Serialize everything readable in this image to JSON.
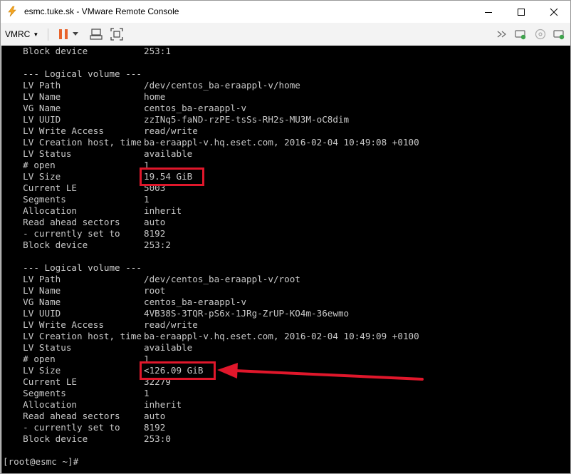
{
  "window": {
    "title": "esmc.tuke.sk - VMware Remote Console",
    "minimize_icon": "minimize-icon",
    "maximize_icon": "maximize-icon",
    "close_icon": "close-icon"
  },
  "toolbar": {
    "menu_label": "VMRC",
    "icons": [
      "pause-icon",
      "dropdown-icon",
      "send-ctrl-alt-del-icon",
      "fullscreen-icon",
      "forward-icon",
      "removable-devices-icon",
      "cd-icon",
      "help-icon"
    ]
  },
  "console": {
    "lines": [
      {
        "k": "  Block device",
        "v": "253:1"
      },
      {
        "k": "",
        "v": ""
      },
      {
        "k": "  --- Logical volume ---",
        "v": ""
      },
      {
        "k": "  LV Path",
        "v": "/dev/centos_ba-eraappl-v/home"
      },
      {
        "k": "  LV Name",
        "v": "home"
      },
      {
        "k": "  VG Name",
        "v": "centos_ba-eraappl-v"
      },
      {
        "k": "  LV UUID",
        "v": "zzINq5-faND-rzPE-tsSs-RH2s-MU3M-oC8dim"
      },
      {
        "k": "  LV Write Access",
        "v": "read/write"
      },
      {
        "k": "  LV Creation host, time",
        "v": "ba-eraappl-v.hq.eset.com, 2016-02-04 10:49:08 +0100"
      },
      {
        "k": "  LV Status",
        "v": "available"
      },
      {
        "k": "  # open",
        "v": "1"
      },
      {
        "k": "  LV Size",
        "v": "19.54 GiB"
      },
      {
        "k": "  Current LE",
        "v": "5003"
      },
      {
        "k": "  Segments",
        "v": "1"
      },
      {
        "k": "  Allocation",
        "v": "inherit"
      },
      {
        "k": "  Read ahead sectors",
        "v": "auto"
      },
      {
        "k": "  - currently set to",
        "v": "8192"
      },
      {
        "k": "  Block device",
        "v": "253:2"
      },
      {
        "k": "",
        "v": ""
      },
      {
        "k": "  --- Logical volume ---",
        "v": ""
      },
      {
        "k": "  LV Path",
        "v": "/dev/centos_ba-eraappl-v/root"
      },
      {
        "k": "  LV Name",
        "v": "root"
      },
      {
        "k": "  VG Name",
        "v": "centos_ba-eraappl-v"
      },
      {
        "k": "  LV UUID",
        "v": "4VB38S-3TQR-pS6x-1JRg-ZrUP-KO4m-36ewmo"
      },
      {
        "k": "  LV Write Access",
        "v": "read/write"
      },
      {
        "k": "  LV Creation host, time",
        "v": "ba-eraappl-v.hq.eset.com, 2016-02-04 10:49:09 +0100"
      },
      {
        "k": "  LV Status",
        "v": "available"
      },
      {
        "k": "  # open",
        "v": "1"
      },
      {
        "k": "  LV Size",
        "v": "<126.09 GiB"
      },
      {
        "k": "  Current LE",
        "v": "32279"
      },
      {
        "k": "  Segments",
        "v": "1"
      },
      {
        "k": "  Allocation",
        "v": "inherit"
      },
      {
        "k": "  Read ahead sectors",
        "v": "auto"
      },
      {
        "k": "  - currently set to",
        "v": "8192"
      },
      {
        "k": "  Block device",
        "v": "253:0"
      }
    ],
    "prompt": "[root@esmc ~]#"
  },
  "annotation": {
    "color": "#e0172b"
  }
}
